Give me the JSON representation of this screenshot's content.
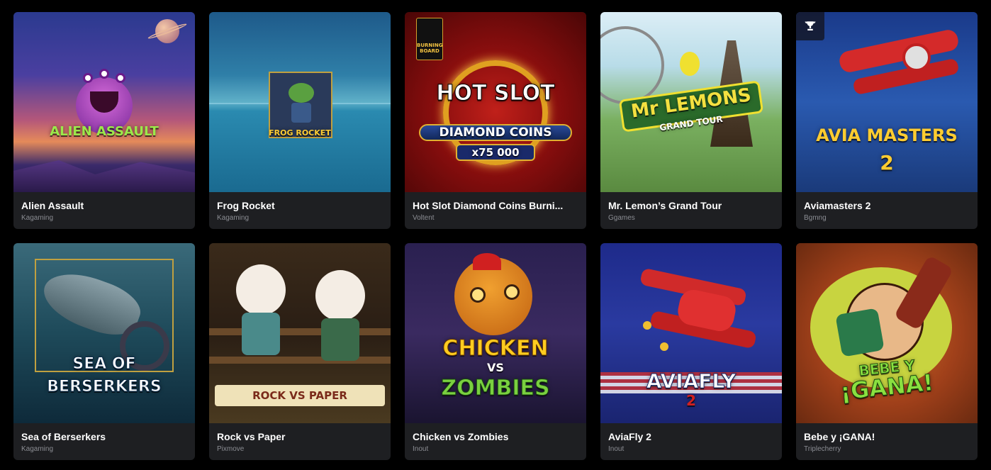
{
  "games": [
    {
      "title": "Alien Assault",
      "provider": "Kagaming",
      "art": "ALIEN ASSAULT"
    },
    {
      "title": "Frog Rocket",
      "provider": "Kagaming",
      "art": "FROG ROCKET"
    },
    {
      "title": "Hot Slot Diamond Coins Burni...",
      "provider": "Voltent",
      "art": "HOT SLOT",
      "art2": "DIAMOND COINS",
      "art3": "x75 000",
      "corner": "BURNING BOARD"
    },
    {
      "title": "Mr. Lemon’s Grand Tour",
      "provider": "Ggames",
      "art": "Mr LEMONS",
      "art2": "GRAND TOUR"
    },
    {
      "title": "Aviamasters 2",
      "provider": "Bgmng",
      "art": "AVIA MASTERS",
      "art2": "2"
    },
    {
      "title": "Sea of Berserkers",
      "provider": "Kagaming",
      "art": "SEA OF",
      "art2": "BERSERKERS"
    },
    {
      "title": "Rock vs Paper",
      "provider": "Pixmove",
      "art": "ROCK VS PAPER"
    },
    {
      "title": "Chicken vs Zombies",
      "provider": "Inout",
      "art": "CHICKEN",
      "art2": "VS",
      "art3": "ZOMBIES"
    },
    {
      "title": "AviaFly 2",
      "provider": "Inout",
      "art": "AVIAFLY",
      "art2": "2"
    },
    {
      "title": "Bebe y ¡GANA!",
      "provider": "Triplecherry",
      "art": "BEBE Y",
      "art2": "¡GANA!"
    }
  ]
}
